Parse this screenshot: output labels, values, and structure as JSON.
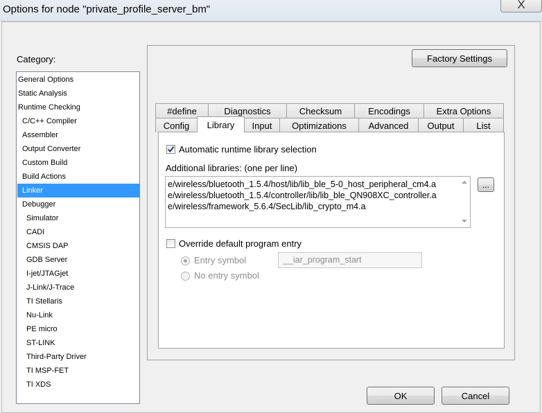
{
  "window": {
    "title": "Options for node \"private_profile_server_bm\"",
    "close_label": "X"
  },
  "category": {
    "label": "Category:",
    "items": [
      {
        "label": "General Options"
      },
      {
        "label": "Static Analysis"
      },
      {
        "label": "Runtime Checking"
      },
      {
        "label": "C/C++ Compiler"
      },
      {
        "label": "Assembler"
      },
      {
        "label": "Output Converter"
      },
      {
        "label": "Custom Build"
      },
      {
        "label": "Build Actions"
      },
      {
        "label": "Linker"
      },
      {
        "label": "Debugger"
      },
      {
        "label": "Simulator"
      },
      {
        "label": "CADI"
      },
      {
        "label": "CMSIS DAP"
      },
      {
        "label": "GDB Server"
      },
      {
        "label": "I-jet/JTAGjet"
      },
      {
        "label": "J-Link/J-Trace"
      },
      {
        "label": "TI Stellaris"
      },
      {
        "label": "Nu-Link"
      },
      {
        "label": "PE micro"
      },
      {
        "label": "ST-LINK"
      },
      {
        "label": "Third-Party Driver"
      },
      {
        "label": "TI MSP-FET"
      },
      {
        "label": "TI XDS"
      }
    ],
    "selected": "Linker"
  },
  "factory_settings_label": "Factory Settings",
  "tabs": {
    "back_row": [
      "#define",
      "Diagnostics",
      "Checksum",
      "Encodings",
      "Extra Options"
    ],
    "front_row": [
      "Config",
      "Library",
      "Input",
      "Optimizations",
      "Advanced",
      "Output",
      "List"
    ],
    "active": "Library"
  },
  "library_tab": {
    "auto_runtime": {
      "label": "Automatic runtime library selection",
      "checked": true
    },
    "additional_label": "Additional libraries: (one per line)",
    "libraries": [
      "e/wireless/bluetooth_1.5.4/host/lib/lib_ble_5-0_host_peripheral_cm4.a",
      "e/wireless/bluetooth_1.5.4/controller/lib/lib_ble_QN908XC_controller.a",
      "e/wireless/framework_5.6.4/SecLib/lib_crypto_m4.a"
    ],
    "browse_label": "...",
    "override": {
      "label": "Override default program entry",
      "checked": false
    },
    "entry_symbol": {
      "label": "Entry symbol",
      "value": "__iar_program_start",
      "selected": true
    },
    "no_entry_symbol": {
      "label": "No entry symbol",
      "selected": false
    }
  },
  "buttons": {
    "ok": "OK",
    "cancel": "Cancel"
  }
}
